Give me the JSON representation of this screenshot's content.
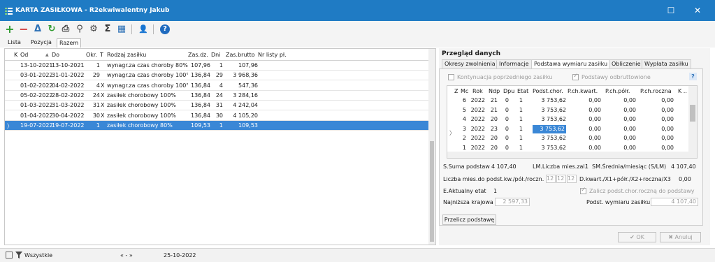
{
  "window": {
    "title": "KARTA ZASIŁKOWA - R2ekwiwalentny Jakub",
    "maximize_glyph": "☐",
    "close_glyph": "✕"
  },
  "toolbar": {
    "icons": [
      "add-icon",
      "remove-icon",
      "edit-icon",
      "refresh-icon",
      "print-icon",
      "search-icon",
      "filter-icon",
      "sum-icon",
      "columns-icon",
      "user-icon",
      "help-icon"
    ],
    "glyphs": {
      "add": "+",
      "remove": "−",
      "edit": "Δ",
      "refresh": "↻",
      "print": "⎙",
      "search": "⚲",
      "filter": "⚙",
      "sum": "Σ",
      "columns": "▦",
      "user": "👤",
      "help": "?"
    }
  },
  "left_tabs": [
    "Lista",
    "Pozycja",
    "Razem"
  ],
  "grid": {
    "headers": {
      "k": "K",
      "od": "Od",
      "do": "Do",
      "okr": "Okr.",
      "t": "T",
      "rodzaj": "Rodzaj zasiłku",
      "zasdz": "Zas.dz.",
      "dni": "Dni",
      "zasbrutto": "Zas.brutto",
      "nrlisty": "Nr listy pł."
    },
    "sort_glyph": "▲",
    "row_indicator": "〉",
    "rows": [
      {
        "od": "13-10-2021",
        "do": "13-10-2021",
        "okr": "1",
        "t": "",
        "rodzaj": "wynagr.za czas choroby 80%",
        "zasdz": "107,96",
        "dni": "1",
        "brutto": "107,96",
        "nr": ""
      },
      {
        "od": "03-01-2022",
        "do": "31-01-2022",
        "okr": "29",
        "t": "",
        "rodzaj": "wynagr.za czas choroby 100°",
        "zasdz": "136,84",
        "dni": "29",
        "brutto": "3 968,36",
        "nr": ""
      },
      {
        "od": "01-02-2022",
        "do": "04-02-2022",
        "okr": "4",
        "t": "X",
        "rodzaj": "wynagr.za czas choroby 100°",
        "zasdz": "136,84",
        "dni": "4",
        "brutto": "547,36",
        "nr": ""
      },
      {
        "od": "05-02-2022",
        "do": "28-02-2022",
        "okr": "24",
        "t": "X",
        "rodzaj": "zasiłek chorobowy 100%",
        "zasdz": "136,84",
        "dni": "24",
        "brutto": "3 284,16",
        "nr": ""
      },
      {
        "od": "01-03-2022",
        "do": "31-03-2022",
        "okr": "31",
        "t": "X",
        "rodzaj": "zasiłek chorobowy 100%",
        "zasdz": "136,84",
        "dni": "31",
        "brutto": "4 242,04",
        "nr": ""
      },
      {
        "od": "01-04-2022",
        "do": "30-04-2022",
        "okr": "30",
        "t": "X",
        "rodzaj": "zasiłek chorobowy 100%",
        "zasdz": "136,84",
        "dni": "30",
        "brutto": "4 105,20",
        "nr": ""
      },
      {
        "od": "19-07-2022",
        "do": "19-07-2022",
        "okr": "1",
        "t": "",
        "rodzaj": "zasiłek chorobowy 80%",
        "zasdz": "109,53",
        "dni": "1",
        "brutto": "109,53",
        "nr": ""
      }
    ]
  },
  "right": {
    "title": "Przegląd danych",
    "tabs": [
      "Okresy zwolnienia",
      "Informacje",
      "Podstawa wymiaru zasiłku",
      "Obliczenie",
      "Wypłata zasiłku"
    ],
    "kontynuacja_label": "Kontynuacja poprzedniego zasiłku",
    "podstawy_label": "Podstawy odbruttowione",
    "help_glyph": "?",
    "inner_headers": {
      "z": "Z",
      "mc": "Mc",
      "rok": "Rok",
      "ndp": "Ndp",
      "dpu": "Dpu",
      "etat": "Etat",
      "podst": "Podst.chor.",
      "kwart": "P.ch.kwart.",
      "polr": "P.ch.półr.",
      "roczna": "P.ch.roczna",
      "k": "K ..",
      "corner": ".."
    },
    "inner_rows": [
      {
        "mc": "6",
        "rok": "2022",
        "ndp": "21",
        "dpu": "0",
        "etat": "1",
        "podst": "3 753,62",
        "kwart": "0,00",
        "polr": "0,00",
        "roczna": "0,00"
      },
      {
        "mc": "5",
        "rok": "2022",
        "ndp": "21",
        "dpu": "0",
        "etat": "1",
        "podst": "3 753,62",
        "kwart": "0,00",
        "polr": "0,00",
        "roczna": "0,00"
      },
      {
        "mc": "4",
        "rok": "2022",
        "ndp": "20",
        "dpu": "0",
        "etat": "1",
        "podst": "3 753,62",
        "kwart": "0,00",
        "polr": "0,00",
        "roczna": "0,00"
      },
      {
        "mc": "3",
        "rok": "2022",
        "ndp": "23",
        "dpu": "0",
        "etat": "1",
        "podst": "3 753,62",
        "kwart": "0,00",
        "polr": "0,00",
        "roczna": "0,00"
      },
      {
        "mc": "2",
        "rok": "2022",
        "ndp": "20",
        "dpu": "0",
        "etat": "1",
        "podst": "3 753,62",
        "kwart": "0,00",
        "polr": "0,00",
        "roczna": "0,00"
      },
      {
        "mc": "1",
        "rok": "2022",
        "ndp": "20",
        "dpu": "0",
        "etat": "1",
        "podst": "3 753,62",
        "kwart": "0,00",
        "polr": "0,00",
        "roczna": "0,00"
      }
    ],
    "suma_label": "S.Suma podstaw",
    "suma_value": "4 107,40",
    "liczba_label": "LM.Liczba mies.zal.",
    "liczba_value": "1",
    "srednia_label": "SM.Średnia/miesiąc (S/LM)",
    "srednia_value": "4 107,40",
    "liczba_mies_label": "Liczba mies.do podst.kw./pół./roczn.",
    "liczba_mies_values": [
      "12",
      "12",
      "12"
    ],
    "dkwart_label": "D.kwart./X1+półr./X2+roczna/X3",
    "dkwart_value": "0,00",
    "etat_label": "E.Aktualny etat",
    "etat_value": "1",
    "zalicz_label": "Zalicz podst.chor.roczną do podstawy",
    "najnizsza_label": "Najniższa krajowa",
    "najnizsza_value": "2 597,33",
    "podstawa_label": "Podst. wymiaru zasiłku",
    "podstawa_value": "4 107,40",
    "przelicz_label": "Przelicz podstawę"
  },
  "footer": {
    "ok_label": "OK",
    "anuluj_label": "Anuluj",
    "ok_glyph": "✔",
    "anuluj_glyph": "✖"
  },
  "statusbar": {
    "filter_label": "Wszystkie",
    "nav": "« - »",
    "date": "25-10-2022"
  },
  "colors": {
    "titlebar": "#1f7bc4",
    "selection": "#3a87d6",
    "add": "#2e9a2e",
    "remove": "#d23a3a",
    "help": "#1f6bbf"
  }
}
